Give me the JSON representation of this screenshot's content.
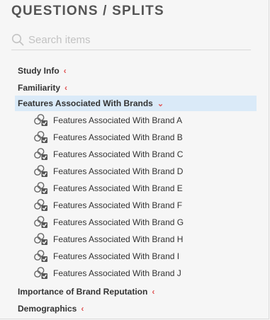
{
  "panel": {
    "title": "QUESTIONS / SPLITS"
  },
  "search": {
    "placeholder": "Search items",
    "icon": "search-icon"
  },
  "tree": {
    "study_info": "Study Info",
    "familiarity": "Familiarity",
    "features_group": "Features Associated With Brands",
    "features_children": [
      "Features Associated With Brand A",
      "Features Associated With Brand B",
      "Features Associated With Brand C",
      "Features Associated With Brand D",
      "Features Associated With Brand E",
      "Features Associated With Brand F",
      "Features Associated With Brand G",
      "Features Associated With Brand H",
      "Features Associated With Brand I",
      "Features Associated With Brand J"
    ],
    "importance": "Importance of Brand Reputation",
    "demographics": "Demographics"
  },
  "colors": {
    "accent_chevron": "#e05555",
    "selected_bg": "#daeaf8"
  }
}
